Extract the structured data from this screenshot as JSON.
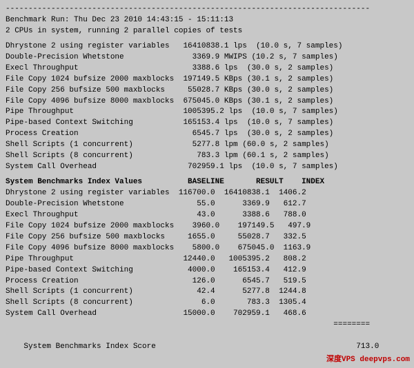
{
  "terminal": {
    "separator": "--------------------------------------------------------------------------------",
    "header1": "Benchmark Run: Thu Dec 23 2010 14:43:15 - 15:11:13",
    "header2": "2 CPUs in system, running 2 parallel copies of tests",
    "blank1": "",
    "tests": [
      {
        "name": "Dhrystone 2 using register variables",
        "value": "16410838.1 lps ",
        "detail": "(10.0 s, 7 samples)"
      },
      {
        "name": "Double-Precision Whetstone            ",
        "value": "  3369.9 MWIPS",
        "detail": "(10.2 s, 7 samples)"
      },
      {
        "name": "Execl Throughput                      ",
        "value": "  3388.6 lps ",
        "detail": "(30.0 s, 2 samples)"
      },
      {
        "name": "File Copy 1024 bufsize 2000 maxblocks ",
        "value": "197149.5 KBps",
        "detail": "(30.1 s, 2 samples)"
      },
      {
        "name": "File Copy 256 bufsize 500 maxblocks   ",
        "value": " 55028.7 KBps",
        "detail": "(30.0 s, 2 samples)"
      },
      {
        "name": "File Copy 4096 bufsize 8000 maxblocks ",
        "value": "675045.0 KBps",
        "detail": "(30.1 s, 2 samples)"
      },
      {
        "name": "Pipe Throughput                       ",
        "value": "1005395.2 lps ",
        "detail": "(10.0 s, 7 samples)"
      },
      {
        "name": "Pipe-based Context Switching          ",
        "value": "165153.4 lps ",
        "detail": "(10.0 s, 7 samples)"
      },
      {
        "name": "Process Creation                      ",
        "value": "  6545.7 lps ",
        "detail": "(30.0 s, 2 samples)"
      },
      {
        "name": "Shell Scripts (1 concurrent)          ",
        "value": "  5277.8 lpm",
        "detail": "(60.0 s, 2 samples)"
      },
      {
        "name": "Shell Scripts (8 concurrent)          ",
        "value": "   783.3 lpm",
        "detail": "(60.1 s, 2 samples)"
      },
      {
        "name": "System Call Overhead                  ",
        "value": " 702959.1 lps ",
        "detail": "(10.0 s, 7 samples)"
      }
    ],
    "blank2": "",
    "index_header": "System Benchmarks Index Values          BASELINE       RESULT    INDEX",
    "index_rows": [
      {
        "name": "Dhrystone 2 using register variables",
        "baseline": "116700.0",
        "result": "16410838.1",
        "index": "1406.2"
      },
      {
        "name": "Double-Precision Whetstone          ",
        "baseline": "    55.0",
        "result": "    3369.9",
        "index": " 612.7"
      },
      {
        "name": "Execl Throughput                    ",
        "baseline": "    43.0",
        "result": "    3388.6",
        "index": " 788.0"
      },
      {
        "name": "File Copy 1024 bufsize 2000 maxblocks",
        "baseline": "  3960.0",
        "result": "  197149.5",
        "index": " 497.9"
      },
      {
        "name": "File Copy 256 bufsize 500 maxblocks ",
        "baseline": "  1655.0",
        "result": "   55028.7",
        "index": " 332.5"
      },
      {
        "name": "File Copy 4096 bufsize 8000 maxblocks",
        "baseline": "  5800.0",
        "result": "  675045.0",
        "index": "1163.9"
      },
      {
        "name": "Pipe Throughput                     ",
        "baseline": " 12440.0",
        "result": " 1005395.2",
        "index": " 808.2"
      },
      {
        "name": "Pipe-based Context Switching        ",
        "baseline": "  4000.0",
        "result": "  165153.4",
        "index": " 412.9"
      },
      {
        "name": "Process Creation                    ",
        "baseline": "   126.0",
        "result": "    6545.7",
        "index": " 519.5"
      },
      {
        "name": "Shell Scripts (1 concurrent)        ",
        "baseline": "    42.4",
        "result": "    5277.8",
        "index": "1244.8"
      },
      {
        "name": "Shell Scripts (8 concurrent)        ",
        "baseline": "     6.0",
        "result": "     783.3",
        "index": "1305.4"
      },
      {
        "name": "System Call Overhead                ",
        "baseline": " 15000.0",
        "result": "  702959.1",
        "index": " 468.6"
      }
    ],
    "equals": "                                                                        ========",
    "score_label": "System Benchmarks Index Score                                           ",
    "score_value": " 713.0",
    "watermark": "深度VPS deepvps.com"
  }
}
